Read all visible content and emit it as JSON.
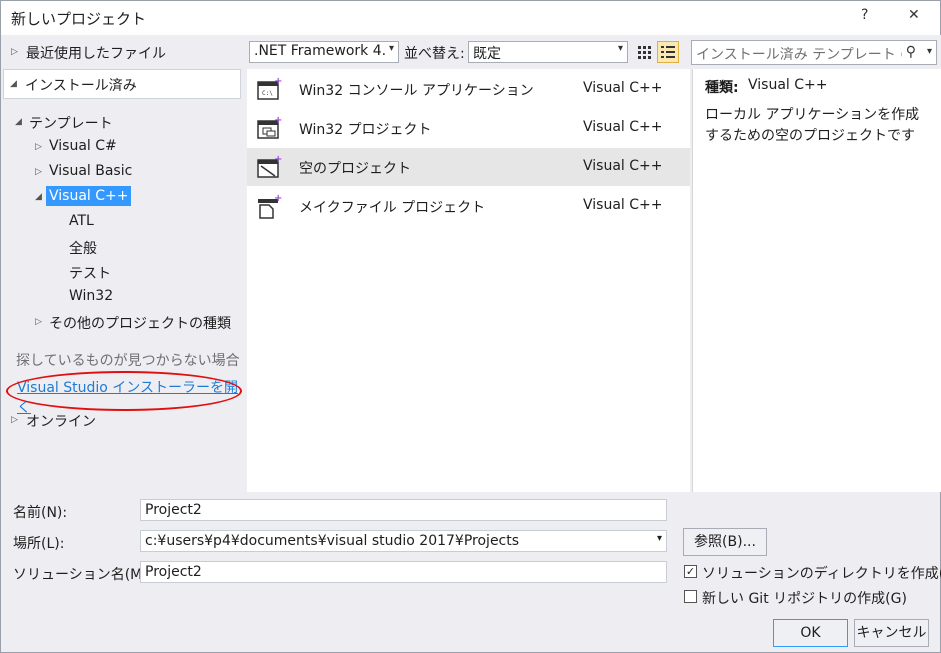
{
  "window": {
    "title": "新しいプロジェクト",
    "help_button": "?",
    "close_button": "✕"
  },
  "sidebar": {
    "recent": "最近使用したファイル",
    "installed": "インストール済み",
    "templates": "テンプレート",
    "tree": {
      "visual_csharp": "Visual C#",
      "visual_basic": "Visual Basic",
      "visual_cpp": "Visual C++",
      "atl": "ATL",
      "general": "全般",
      "test": "テスト",
      "win32": "Win32",
      "other_types": "その他のプロジェクトの種類"
    },
    "hint": "探しているものが見つからない場合",
    "installer_link": "Visual Studio インストーラーを開く",
    "online": "オンライン"
  },
  "toolbar": {
    "framework": ".NET Framework 4.",
    "sort_label": "並べ替え:",
    "sort_value": "既定",
    "search_placeholder": "インストール済み テンプレート の検索"
  },
  "templates": [
    {
      "name": "Win32 コンソール アプリケーション",
      "lang": "Visual C++",
      "icon": "console-app-icon"
    },
    {
      "name": "Win32 プロジェクト",
      "lang": "Visual C++",
      "icon": "win32-project-icon"
    },
    {
      "name": "空のプロジェクト",
      "lang": "Visual C++",
      "icon": "empty-project-icon"
    },
    {
      "name": "メイクファイル プロジェクト",
      "lang": "Visual C++",
      "icon": "makefile-project-icon"
    }
  ],
  "details": {
    "type_label": "種類:",
    "type_value": "Visual C++",
    "description": "ローカル アプリケーションを作成するための空のプロジェクトです"
  },
  "form": {
    "name_label": "名前(N):",
    "name_value": "Project2",
    "location_label": "場所(L):",
    "location_value": "c:¥users¥p4¥documents¥visual studio 2017¥Projects",
    "solution_label": "ソリューション名(M):",
    "solution_value": "Project2",
    "browse_button": "参照(B)...",
    "create_dir_label": "ソリューションのディレクトリを作成(D)",
    "create_dir_checked": true,
    "git_label": "新しい Git リポジトリの作成(G)",
    "git_checked": false,
    "ok_button": "OK",
    "cancel_button": "キャンセル"
  }
}
